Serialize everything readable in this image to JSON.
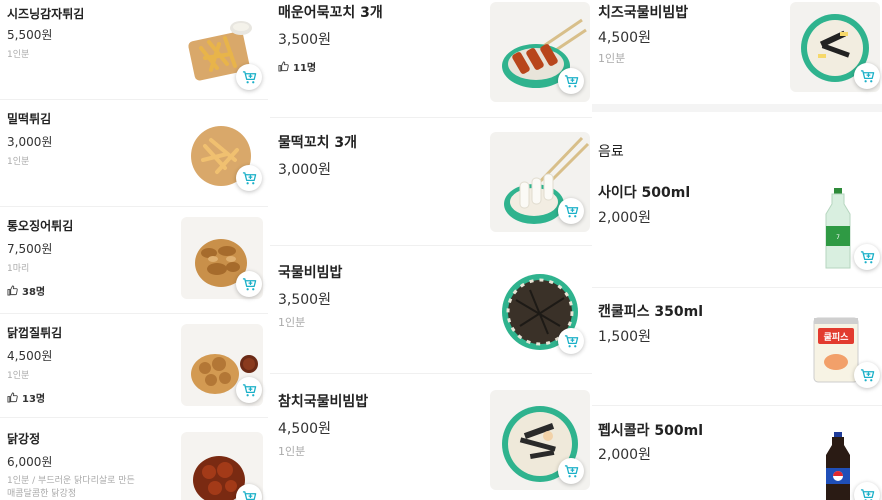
{
  "colors": {
    "accent": "#1bb0c8",
    "divider": "#f0f0f0",
    "muted": "#aaaaaa"
  },
  "icons": {
    "cart": "cart-plus-icon",
    "like": "thumbs-up-icon"
  },
  "col1": [
    {
      "name": "시즈닝감자튀김",
      "price": "5,500원",
      "desc": "1인분"
    },
    {
      "name": "밀떡튀김",
      "price": "3,000원",
      "desc": "1인분"
    },
    {
      "name": "통오징어튀김",
      "price": "7,500원",
      "desc": "1마리",
      "likes": "38명"
    },
    {
      "name": "닭껍질튀김",
      "price": "4,500원",
      "desc": "1인분",
      "likes": "13명"
    },
    {
      "name": "닭강정",
      "price": "6,000원",
      "desc": "1인분 / 부드러운 닭다리살로 만든",
      "desc2": "매콤달콤한 닭강정"
    }
  ],
  "col2": [
    {
      "name": "매운어묵꼬치 3개",
      "price": "3,500원",
      "likes": "11명"
    },
    {
      "name": "물떡꼬치 3개",
      "price": "3,000원"
    },
    {
      "name": "국물비빔밥",
      "price": "3,500원",
      "desc": "1인분"
    },
    {
      "name": "참치국물비빔밥",
      "price": "4,500원",
      "desc": "1인분"
    }
  ],
  "col3": {
    "top_item": {
      "name": "치즈국물비빔밥",
      "price": "4,500원",
      "desc": "1인분"
    },
    "section_title": "음료",
    "drinks": [
      {
        "name": "사이다 500ml",
        "price": "2,000원"
      },
      {
        "name": "캔쿨피스 350ml",
        "price": "1,500원"
      },
      {
        "name": "펩시콜라 500ml",
        "price": "2,000원"
      }
    ],
    "can_label": "쿨피스"
  }
}
